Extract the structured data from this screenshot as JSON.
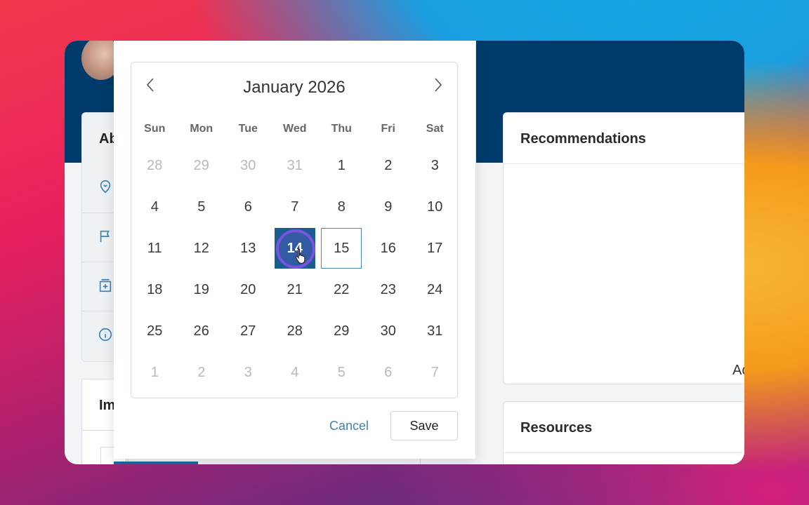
{
  "background": {
    "window_header_color": "#003b6b"
  },
  "left_panel": {
    "card_title": "Ab",
    "icons": [
      "location-heart-icon",
      "flag-icon",
      "add-box-icon",
      "info-icon"
    ],
    "card2_title": "Im"
  },
  "right_panel": {
    "recommendations_title": "Recommendations",
    "partial_text": "Ac",
    "resources_title": "Resources"
  },
  "date_picker": {
    "month_label": "January 2026",
    "prev_icon": "chevron-left-icon",
    "next_icon": "chevron-right-icon",
    "weekdays": [
      "Sun",
      "Mon",
      "Tue",
      "Wed",
      "Thu",
      "Fri",
      "Sat"
    ],
    "days": [
      {
        "label": "28",
        "muted": true
      },
      {
        "label": "29",
        "muted": true
      },
      {
        "label": "30",
        "muted": true
      },
      {
        "label": "31",
        "muted": true
      },
      {
        "label": "1"
      },
      {
        "label": "2"
      },
      {
        "label": "3"
      },
      {
        "label": "4"
      },
      {
        "label": "5"
      },
      {
        "label": "6"
      },
      {
        "label": "7"
      },
      {
        "label": "8"
      },
      {
        "label": "9"
      },
      {
        "label": "10"
      },
      {
        "label": "11"
      },
      {
        "label": "12"
      },
      {
        "label": "13"
      },
      {
        "label": "14",
        "selected": true
      },
      {
        "label": "15",
        "today": true
      },
      {
        "label": "16"
      },
      {
        "label": "17"
      },
      {
        "label": "18"
      },
      {
        "label": "19"
      },
      {
        "label": "20"
      },
      {
        "label": "21"
      },
      {
        "label": "22"
      },
      {
        "label": "23"
      },
      {
        "label": "24"
      },
      {
        "label": "25"
      },
      {
        "label": "26"
      },
      {
        "label": "27"
      },
      {
        "label": "28"
      },
      {
        "label": "29"
      },
      {
        "label": "30"
      },
      {
        "label": "31"
      },
      {
        "label": "1",
        "muted": true
      },
      {
        "label": "2",
        "muted": true
      },
      {
        "label": "3",
        "muted": true
      },
      {
        "label": "4",
        "muted": true
      },
      {
        "label": "5",
        "muted": true
      },
      {
        "label": "6",
        "muted": true
      },
      {
        "label": "7",
        "muted": true
      }
    ],
    "selected_color": "#1a5e91",
    "highlight_ring_color": "#7b53e0",
    "cancel_label": "Cancel",
    "save_label": "Save"
  }
}
